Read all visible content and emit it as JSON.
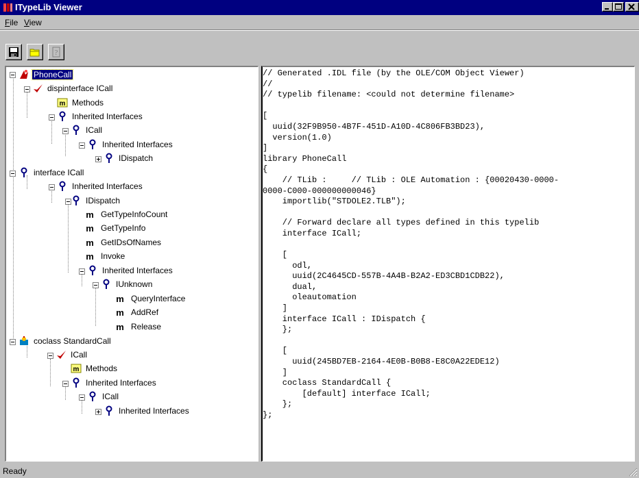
{
  "window": {
    "title": "ITypeLib Viewer",
    "title_icon": "typelib-app-icon",
    "caption_buttons": [
      "minimize-icon",
      "maximize-icon",
      "close-icon"
    ]
  },
  "menubar": {
    "file": {
      "accel": "F",
      "rest": "ile"
    },
    "view": {
      "accel": "V",
      "rest": "iew"
    }
  },
  "toolbar": {
    "buttons": [
      "save-icon",
      "open-folder-icon",
      "help-icon"
    ]
  },
  "tree": {
    "nodes": [
      {
        "label": "PhoneCall",
        "icon": "typelib-icon",
        "selected": true
      },
      {
        "label": "dispinterface ICall",
        "icon": "dispinterface-icon"
      },
      {
        "label": "Methods",
        "icon": "methods-icon"
      },
      {
        "label": "Inherited Interfaces",
        "icon": "interface-icon"
      },
      {
        "label": "ICall",
        "icon": "interface-icon"
      },
      {
        "label": "Inherited Interfaces",
        "icon": "interface-icon"
      },
      {
        "label": "IDispatch",
        "icon": "interface-icon"
      },
      {
        "label": "interface ICall",
        "icon": "interface-icon"
      },
      {
        "label": "Inherited Interfaces",
        "icon": "interface-icon"
      },
      {
        "label": "IDispatch",
        "icon": "interface-icon"
      },
      {
        "label": "GetTypeInfoCount",
        "icon": "method-icon"
      },
      {
        "label": "GetTypeInfo",
        "icon": "method-icon"
      },
      {
        "label": "GetIDsOfNames",
        "icon": "method-icon"
      },
      {
        "label": "Invoke",
        "icon": "method-icon"
      },
      {
        "label": "Inherited Interfaces",
        "icon": "interface-icon"
      },
      {
        "label": "IUnknown",
        "icon": "interface-icon"
      },
      {
        "label": "QueryInterface",
        "icon": "method-icon"
      },
      {
        "label": "AddRef",
        "icon": "method-icon"
      },
      {
        "label": "Release",
        "icon": "method-icon"
      },
      {
        "label": "coclass StandardCall",
        "icon": "coclass-icon"
      },
      {
        "label": "ICall",
        "icon": "dispinterface-icon"
      },
      {
        "label": "Methods",
        "icon": "methods-icon"
      },
      {
        "label": "Inherited Interfaces",
        "icon": "interface-icon"
      },
      {
        "label": "ICall",
        "icon": "interface-icon"
      },
      {
        "label": "Inherited Interfaces",
        "icon": "interface-icon"
      }
    ],
    "method_glyph": "m"
  },
  "code": {
    "text": "// Generated .IDL file (by the OLE/COM Object Viewer)\n//\n// typelib filename: <could not determine filename>\n\n[\n  uuid(32F9B950-4B7F-451D-A10D-4C806FB3BD23),\n  version(1.0)\n]\nlibrary PhoneCall\n{\n    // TLib :     // TLib : OLE Automation : {00020430-0000-\n0000-C000-000000000046}\n    importlib(\"STDOLE2.TLB\");\n\n    // Forward declare all types defined in this typelib\n    interface ICall;\n\n    [\n      odl,\n      uuid(2C4645CD-557B-4A4B-B2A2-ED3CBD1CDB22),\n      dual,\n      oleautomation\n    ]\n    interface ICall : IDispatch {\n    };\n\n    [\n      uuid(245BD7EB-2164-4E0B-B0B8-E8C0A22EDE12)\n    ]\n    coclass StandardCall {\n        [default] interface ICall;\n    };\n};"
  },
  "statusbar": {
    "text": "Ready"
  },
  "colors": {
    "titlebar": "#000080",
    "face": "#c0c0c0",
    "selection": "#000080",
    "icon_red": "#c00000",
    "icon_blue": "#000080"
  }
}
